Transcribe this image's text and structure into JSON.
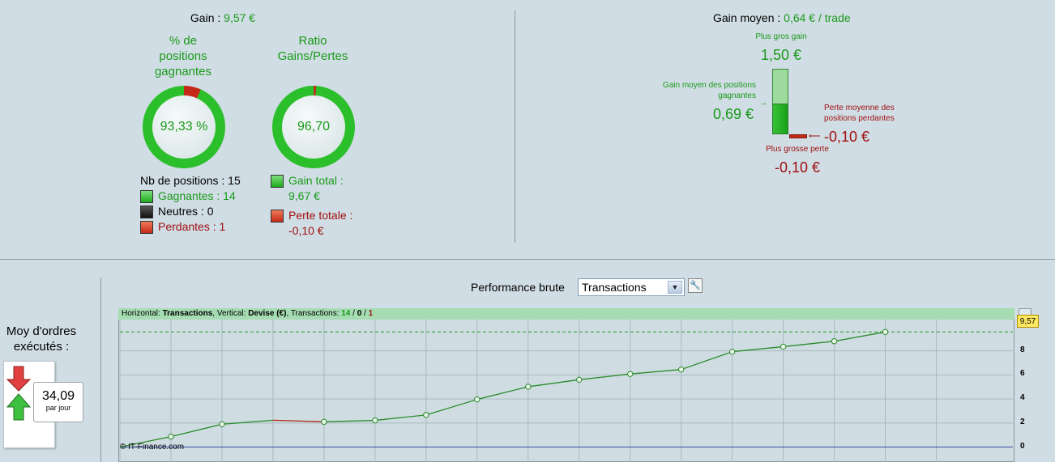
{
  "gain": {
    "label": "Gain : ",
    "value": "9,57 €"
  },
  "win_pct": {
    "title_line1": "% de",
    "title_line2": "positions",
    "title_line3": "gagnantes",
    "value": "93,33 %",
    "fraction": 0.9333
  },
  "ratio": {
    "title_line1": "Ratio",
    "title_line2": "Gains/Pertes",
    "value": "96,70",
    "fraction": 0.9897
  },
  "positions": {
    "total": "Nb de positions : 15",
    "winners": "Gagnantes : 14",
    "neutral": "Neutres : 0",
    "losers": "Perdantes : 1"
  },
  "totals": {
    "gain_label": "Gain total :",
    "gain_value": "9,67 €",
    "loss_label": "Perte totale :",
    "loss_value": "-0,10 €"
  },
  "avg_gain": {
    "label": "Gain moyen : ",
    "value": "0,64 € / trade"
  },
  "bars": {
    "max_gain_label": "Plus gros gain",
    "max_gain_value": "1,50 €",
    "avg_win_label_1": "Gain moyen des positions",
    "avg_win_label_2": "gagnantes",
    "avg_win_value": "0,69 €",
    "avg_loss_label_1": "Perte moyenne des",
    "avg_loss_label_2": "positions perdantes",
    "avg_loss_value": "-0,10 €",
    "max_loss_label": "Plus grosse perte",
    "max_loss_value": "-0,10 €"
  },
  "orders": {
    "title_1": "Moy d'ordres",
    "title_2": "exécutés :",
    "value": "34,09",
    "unit": "par jour"
  },
  "perf": {
    "label": "Performance brute",
    "select_value": "Transactions"
  },
  "chart_legend": {
    "h": "Horizontal: ",
    "h_val": "Transactions",
    "v": ", Vertical: ",
    "v_val": "Devise (€)",
    "t": ", Transactions: ",
    "wins": "14",
    "sep1": " / ",
    "neutral": "0",
    "sep2": " / ",
    "losses": "1"
  },
  "copyright": "© IT-Finance.com",
  "last_value_badge": "9,57",
  "colors": {
    "green": "#1a9a1a",
    "red": "#c42a18",
    "dark_red": "#a01010"
  },
  "chart_data": {
    "type": "line",
    "xlabel": "",
    "ylabel": "",
    "x": [
      0,
      1,
      2,
      3,
      4,
      5,
      6,
      7,
      8,
      9,
      10,
      11,
      12,
      13,
      14,
      15
    ],
    "values": [
      0,
      0.87,
      1.9,
      2.23,
      2.1,
      2.22,
      2.67,
      3.96,
      5.02,
      5.6,
      6.08,
      6.45,
      7.93,
      8.35,
      8.8,
      9.57
    ],
    "losing_segments": [
      [
        3,
        4
      ]
    ],
    "ylim": [
      -0.3,
      10.6
    ],
    "xlim": [
      0,
      17.5
    ],
    "y_ticks": [
      0,
      2,
      4,
      6,
      8
    ],
    "x_ticks": [
      2,
      4,
      6,
      8,
      10,
      12,
      14,
      16
    ],
    "grid": true
  }
}
